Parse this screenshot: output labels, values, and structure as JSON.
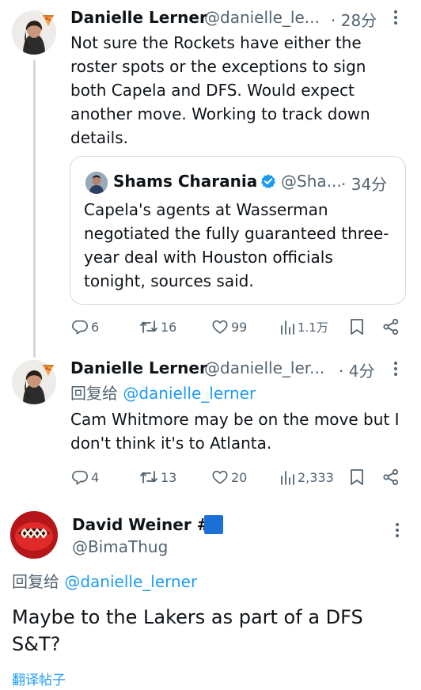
{
  "tweet1": {
    "name": "Danielle Lerner",
    "handle": "@danielle_le...",
    "time": "· 28分",
    "text": "Not sure the Rockets have either the roster spots or the exceptions to sign both Capela and DFS. Would expect another move. Working to track down details.",
    "quote": {
      "name": "Shams Charania",
      "handle": "@Sha...",
      "time": "· 34分",
      "text": "Capela's agents at Wasserman negotiated the fully guaranteed three-year deal with Houston officials tonight, sources said."
    },
    "actions": {
      "replies": "6",
      "reposts": "16",
      "likes": "99",
      "views": "1.1万"
    }
  },
  "tweet2": {
    "name": "Danielle Lerner",
    "handle": "@danielle_ler...",
    "time": "· 4分",
    "reply_prefix": "回复给",
    "reply_to": "@danielle_lerner",
    "text": "Cam Whitmore may be on the move but I don't think it's to Atlanta.",
    "actions": {
      "replies": "4",
      "reposts": "13",
      "likes": "20",
      "views": "2,333"
    }
  },
  "tweet3": {
    "name": "David Weiner #",
    "handle": "@BimaThug",
    "reply_prefix": "回复给",
    "reply_to": "@danielle_lerner",
    "text": "Maybe to the Lakers as part of a DFS S&T?",
    "translate": "翻译帖子"
  },
  "colors": {
    "accent": "#1d9bf0",
    "secondary": "#536471",
    "border": "#cfd9de",
    "verified": "#1d9bf0",
    "flag_square": "#1d6fd8"
  },
  "icons": [
    "pizza-emoji-icon",
    "verified-badge-icon",
    "reply-icon",
    "repost-icon",
    "like-icon",
    "views-icon",
    "bookmark-icon",
    "share-icon",
    "more-icon",
    "blue-square-icon"
  ]
}
